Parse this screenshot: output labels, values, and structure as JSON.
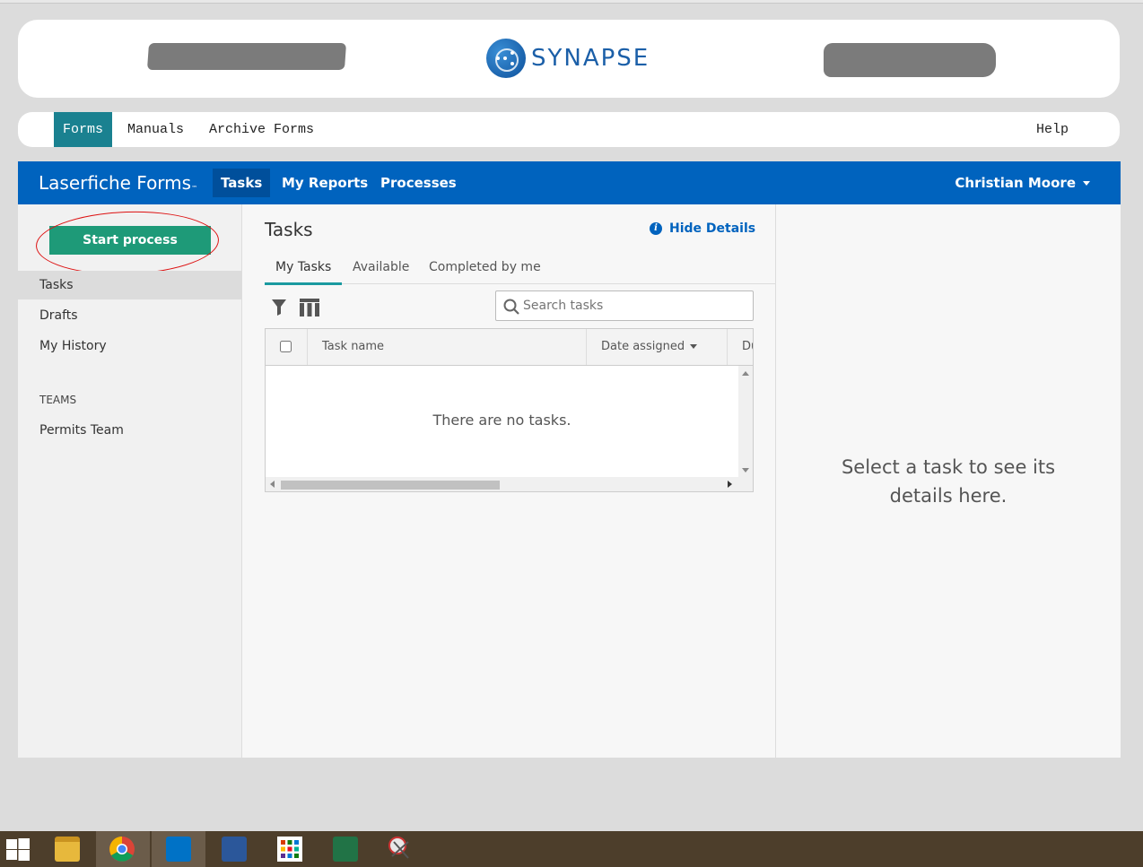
{
  "banner": {
    "logo_text": "SYNAPSE"
  },
  "menubar": {
    "items": [
      "Forms",
      "Manuals",
      "Archive Forms"
    ],
    "help": "Help"
  },
  "appbar": {
    "brand": "Laserfiche Forms",
    "tm": "™",
    "tabs": [
      "Tasks",
      "My Reports",
      "Processes"
    ],
    "user": "Christian Moore"
  },
  "sidebar": {
    "start_button": "Start process",
    "items": [
      "Tasks",
      "Drafts",
      "My History"
    ],
    "teams_header": "TEAMS",
    "teams": [
      "Permits Team"
    ]
  },
  "main": {
    "title": "Tasks",
    "hide_details": "Hide Details",
    "tabs": [
      "My Tasks",
      "Available",
      "Completed by me"
    ],
    "search_placeholder": "Search tasks",
    "columns": [
      "Task name",
      "Date assigned",
      "Du"
    ],
    "empty_message": "There are no tasks."
  },
  "details": {
    "message": "Select a task to see its details here."
  },
  "taskbar": {
    "icons": [
      "windows-start-icon",
      "file-explorer-icon",
      "chrome-icon",
      "outlook-icon",
      "word-icon",
      "apps-grid-icon",
      "excel-icon",
      "snipping-tool-icon"
    ]
  },
  "colors": {
    "appbar_blue": "#0063be",
    "start_button_green": "#1e9a78",
    "forms_tab_teal": "#1a8190",
    "annotation_red": "#d11111"
  }
}
